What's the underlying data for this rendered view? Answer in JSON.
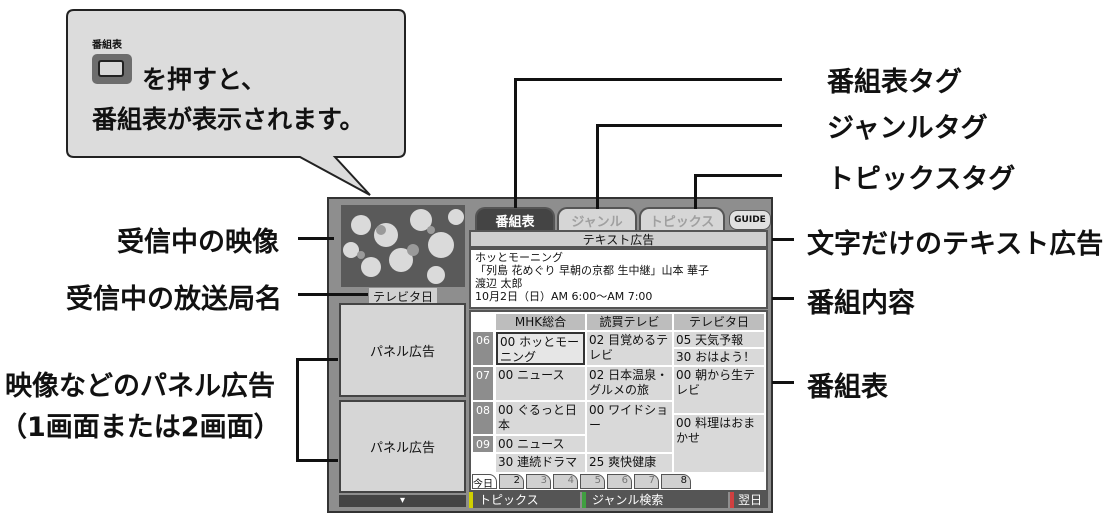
{
  "bubble": {
    "button_caption": "番組表",
    "line1": "を押すと、",
    "line2": "番組表が表示されます。"
  },
  "labels": {
    "receiving_video": "受信中の映像",
    "station_name_label": "受信中の放送局名",
    "panel_ad_label_1": "映像などのパネル広告",
    "panel_ad_label_2": "（1画面または2画面）",
    "tab_program": "番組表タグ",
    "tab_genre": "ジャンルタグ",
    "tab_topics": "トピックスタグ",
    "text_ad_label": "文字だけのテキスト広告",
    "program_content": "番組内容",
    "program_guide": "番組表"
  },
  "screen": {
    "station": "テレビタ日",
    "tabs": [
      "番組表",
      "ジャンル",
      "トピックス"
    ],
    "guide_logo": "GUIDE",
    "text_ad": "テキスト広告",
    "program_info": [
      "ホッとモーニング",
      "「列島 花めぐり 早朝の京都 生中継」山本 華子",
      "渡辺 太郎",
      "10月2日（日）AM 6:00～AM 7:00"
    ],
    "panel_ad_1": "パネル広告",
    "panel_ad_2": "パネル広告",
    "channels": [
      "MHK総合",
      "読買テレビ",
      "テレビタ日"
    ],
    "hours": [
      "06",
      "07",
      "08",
      "09"
    ],
    "programs": {
      "c1_06": "00 ホッとモー\nニング",
      "c1_07": "00 ニュース",
      "c1_08": "00 ぐるっと日\n本",
      "c1_09": "00 ニュース",
      "c1_0930": "30 連続ドラマ",
      "c2_06": "02 目覚めるテ\nレビ",
      "c2_07": "02 日本温泉・\nグルメの旅",
      "c2_08": "00 ワイドショ\nー",
      "c2_0925": "25 爽快健康",
      "c3_06": "05 天気予報",
      "c3_0630": "30 おはよう！",
      "c3_07": "00 朝から生テ\nレビ",
      "c3_08": "00 料理はおま\nかせ"
    },
    "day_tabs": [
      "今日",
      "2",
      "3",
      "4",
      "5",
      "6",
      "7",
      "8"
    ],
    "bottom_buttons": [
      "トピックス",
      "ジャンル検索",
      "翌日"
    ],
    "scroll_arrow": "▾"
  }
}
